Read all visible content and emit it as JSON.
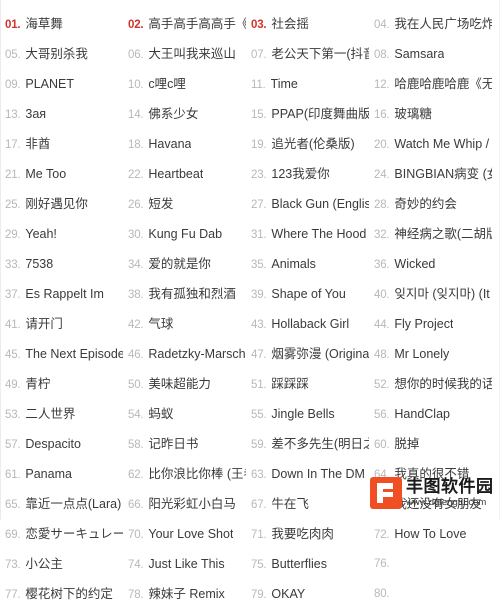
{
  "list": {
    "columns": 4,
    "hot_rank_color": "#d0342c",
    "normal_rank_color": "#b8b8b8",
    "title_color": "#3a3a3a",
    "items": [
      {
        "rank": "01.",
        "title": "海草舞",
        "hot": true
      },
      {
        "rank": "02.",
        "title": "高手高手高高手《太",
        "hot": true
      },
      {
        "rank": "03.",
        "title": "社会摇",
        "hot": true
      },
      {
        "rank": "04.",
        "title": "我在人民广场吃炸鸡",
        "hot": false
      },
      {
        "rank": "05.",
        "title": "大哥别杀我",
        "hot": false
      },
      {
        "rank": "06.",
        "title": "大王叫我来巡山",
        "hot": false
      },
      {
        "rank": "07.",
        "title": "老公天下第一(抖音",
        "hot": false
      },
      {
        "rank": "08.",
        "title": "Samsara",
        "hot": false
      },
      {
        "rank": "09.",
        "title": "PLANET",
        "hot": false
      },
      {
        "rank": "10.",
        "title": "c哩c哩",
        "hot": false
      },
      {
        "rank": "11.",
        "title": "Time",
        "hot": false
      },
      {
        "rank": "12.",
        "title": "哈鹿哈鹿哈鹿《无敌",
        "hot": false
      },
      {
        "rank": "13.",
        "title": "3ая",
        "hot": false
      },
      {
        "rank": "14.",
        "title": "佛系少女",
        "hot": false
      },
      {
        "rank": "15.",
        "title": "PPAP(印度舞曲版)",
        "hot": false
      },
      {
        "rank": "16.",
        "title": "玻璃糖",
        "hot": false
      },
      {
        "rank": "17.",
        "title": "非酋",
        "hot": false
      },
      {
        "rank": "18.",
        "title": "Havana",
        "hot": false
      },
      {
        "rank": "19.",
        "title": "追光者(伦桑版)",
        "hot": false
      },
      {
        "rank": "20.",
        "title": "Watch Me Whip /",
        "hot": false
      },
      {
        "rank": "21.",
        "title": "Me Too",
        "hot": false
      },
      {
        "rank": "22.",
        "title": "Heartbeat",
        "hot": false
      },
      {
        "rank": "23.",
        "title": "123我爱你",
        "hot": false
      },
      {
        "rank": "24.",
        "title": "BINGBIAN病变 (女",
        "hot": false
      },
      {
        "rank": "25.",
        "title": "刚好遇见你",
        "hot": false
      },
      {
        "rank": "26.",
        "title": "短发",
        "hot": false
      },
      {
        "rank": "27.",
        "title": "Black Gun (English",
        "hot": false
      },
      {
        "rank": "28.",
        "title": "奇妙的约会",
        "hot": false
      },
      {
        "rank": "29.",
        "title": "Yeah!",
        "hot": false
      },
      {
        "rank": "30.",
        "title": "Kung Fu Dab",
        "hot": false
      },
      {
        "rank": "31.",
        "title": "Where The Hood",
        "hot": false
      },
      {
        "rank": "32.",
        "title": "神经病之歌(二胡版)",
        "hot": false
      },
      {
        "rank": "33.",
        "title": "7538",
        "hot": false
      },
      {
        "rank": "34.",
        "title": "爱的就是你",
        "hot": false
      },
      {
        "rank": "35.",
        "title": "Animals",
        "hot": false
      },
      {
        "rank": "36.",
        "title": "Wicked",
        "hot": false
      },
      {
        "rank": "37.",
        "title": "Es Rappelt Im",
        "hot": false
      },
      {
        "rank": "38.",
        "title": "我有孤独和烈酒",
        "hot": false
      },
      {
        "rank": "39.",
        "title": "Shape of You",
        "hot": false
      },
      {
        "rank": "40.",
        "title": "잊지마 (잊지마) (It",
        "hot": false
      },
      {
        "rank": "41.",
        "title": "请开门",
        "hot": false
      },
      {
        "rank": "42.",
        "title": "气球",
        "hot": false
      },
      {
        "rank": "43.",
        "title": "Hollaback Girl",
        "hot": false
      },
      {
        "rank": "44.",
        "title": "Fly Project",
        "hot": false
      },
      {
        "rank": "45.",
        "title": "The Next Episode",
        "hot": false
      },
      {
        "rank": "46.",
        "title": "Radetzky-Marsch,",
        "hot": false
      },
      {
        "rank": "47.",
        "title": "烟雾弥漫 (Original",
        "hot": false
      },
      {
        "rank": "48.",
        "title": "Mr Lonely",
        "hot": false
      },
      {
        "rank": "49.",
        "title": "青柠",
        "hot": false
      },
      {
        "rank": "50.",
        "title": "美味超能力",
        "hot": false
      },
      {
        "rank": "51.",
        "title": "踩踩踩",
        "hot": false
      },
      {
        "rank": "52.",
        "title": "想你的时候我的话就",
        "hot": false
      },
      {
        "rank": "53.",
        "title": "二人世界",
        "hot": false
      },
      {
        "rank": "54.",
        "title": "蚂蚁",
        "hot": false
      },
      {
        "rank": "55.",
        "title": "Jingle Bells",
        "hot": false
      },
      {
        "rank": "56.",
        "title": "HandClap",
        "hot": false
      },
      {
        "rank": "57.",
        "title": "Despacito",
        "hot": false
      },
      {
        "rank": "58.",
        "title": "记昨日书",
        "hot": false
      },
      {
        "rank": "59.",
        "title": "差不多先生(明日之",
        "hot": false
      },
      {
        "rank": "60.",
        "title": "脱掉",
        "hot": false
      },
      {
        "rank": "61.",
        "title": "Panama",
        "hot": false
      },
      {
        "rank": "62.",
        "title": "比你浪比你棒 (王者",
        "hot": false
      },
      {
        "rank": "63.",
        "title": "Down In The DM",
        "hot": false
      },
      {
        "rank": "64.",
        "title": "我真的很不错",
        "hot": false
      },
      {
        "rank": "65.",
        "title": "靠近一点点(Lara)",
        "hot": false
      },
      {
        "rank": "66.",
        "title": "阳光彩虹小白马",
        "hot": false
      },
      {
        "rank": "67.",
        "title": "牛在飞",
        "hot": false
      },
      {
        "rank": "68.",
        "title": "我还没有女朋友",
        "hot": false
      },
      {
        "rank": "69.",
        "title": "恋愛サーキュレーシ",
        "hot": false
      },
      {
        "rank": "70.",
        "title": "Your Love Shot",
        "hot": false
      },
      {
        "rank": "71.",
        "title": "我要吃肉肉",
        "hot": false
      },
      {
        "rank": "72.",
        "title": "How To Love",
        "hot": false
      },
      {
        "rank": "73.",
        "title": "小公主",
        "hot": false
      },
      {
        "rank": "74.",
        "title": "Just Like This",
        "hot": false
      },
      {
        "rank": "75.",
        "title": "Butterflies",
        "hot": false
      },
      {
        "rank": "76.",
        "title": "",
        "hot": false
      },
      {
        "rank": "77.",
        "title": "樱花树下的约定",
        "hot": false
      },
      {
        "rank": "78.",
        "title": "辣妹子 Remix",
        "hot": false
      },
      {
        "rank": "79.",
        "title": "OKAY",
        "hot": false
      },
      {
        "rank": "80.",
        "title": "",
        "hot": false
      }
    ]
  },
  "watermark": {
    "name": "丰图软件园",
    "url": "www.dgfengtu.com",
    "logo_color": "#f04e23"
  }
}
